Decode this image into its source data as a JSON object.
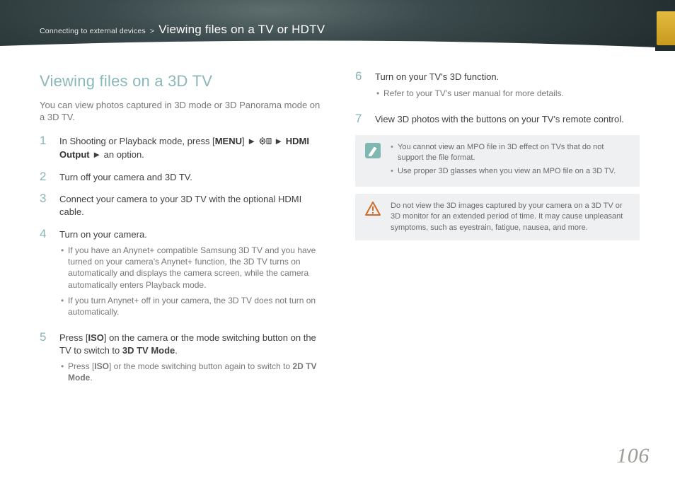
{
  "header": {
    "section": "Connecting to external devices",
    "sep": ">",
    "title": "Viewing files on a TV or HDTV"
  },
  "left": {
    "heading": "Viewing files on a 3D TV",
    "lead": "You can view photos captured in 3D mode or 3D Panorama mode on a 3D TV.",
    "steps": {
      "s1": {
        "n": "1",
        "pre": "In Shooting or Playback mode, press [",
        "menu": "MENU",
        "mid1": "] ► ",
        "mid2": " ► ",
        "hdmi": "HDMI Output",
        "post": " ► an option."
      },
      "s2": {
        "n": "2",
        "t": "Turn off your camera and 3D TV."
      },
      "s3": {
        "n": "3",
        "t": "Connect your camera to your 3D TV with the optional HDMI cable."
      },
      "s4": {
        "n": "4",
        "t": "Turn on your camera.",
        "b1": "If you have an Anynet+ compatible Samsung 3D TV and you have turned on your camera's Anynet+ function, the 3D TV turns on automatically and displays the camera screen, while the camera automatically enters Playback mode.",
        "b2": "If you turn Anynet+ off in your camera, the 3D TV does not turn on automatically."
      },
      "s5": {
        "n": "5",
        "pre": "Press [",
        "iso": "ISO",
        "mid": "] on the camera or the mode switching button on the TV to switch to ",
        "mode": "3D TV Mode",
        "post": ".",
        "sub_pre": "Press [",
        "sub_iso": "ISO",
        "sub_mid": "] or the mode switching button again to switch to ",
        "sub_mode": "2D TV Mode",
        "sub_post": "."
      }
    }
  },
  "right": {
    "steps": {
      "s6": {
        "n": "6",
        "t": "Turn on your TV's 3D function.",
        "b1": "Refer to your TV's user manual for more details."
      },
      "s7": {
        "n": "7",
        "t": "View 3D photos with the buttons on your TV's remote control."
      }
    },
    "note": {
      "b1": "You cannot view an MPO file in 3D effect on TVs that do not support the file format.",
      "b2": "Use proper 3D glasses when you view an MPO file on a 3D TV."
    },
    "warn": "Do not view the 3D images captured by your camera on a 3D TV or 3D monitor for an extended period of time. It may cause unpleasant symptoms, such as eyestrain, fatigue, nausea, and more."
  },
  "page_number": "106"
}
